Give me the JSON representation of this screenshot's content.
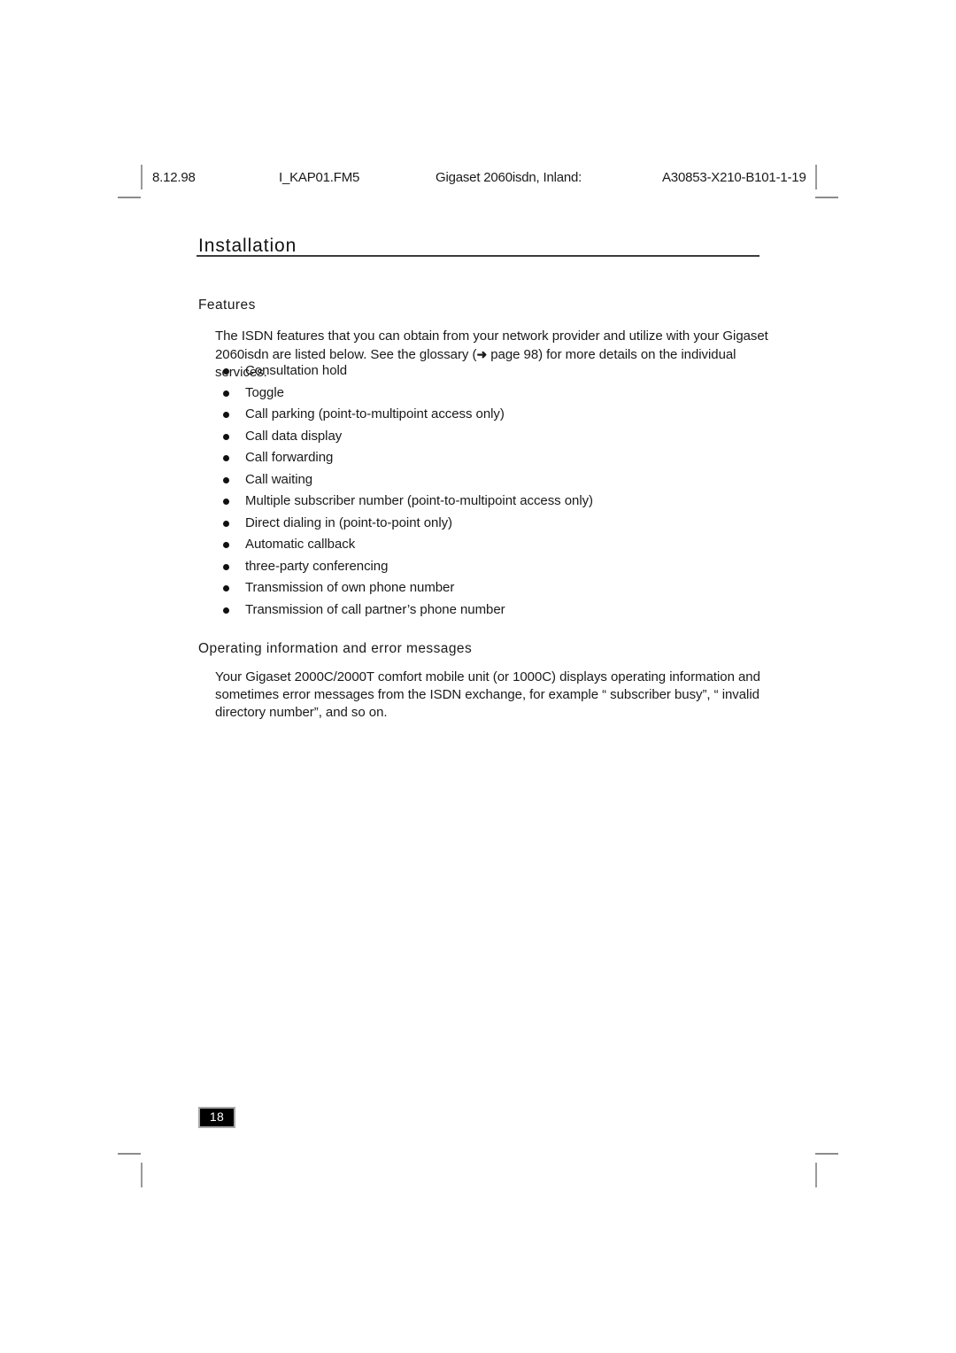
{
  "header": {
    "date": "8.12.98",
    "file": "I_KAP01.FM5",
    "document": "Gigaset 2060isdn, Inland:",
    "code": "A30853-X210-B101-1-19"
  },
  "chapter": {
    "title": "Installation"
  },
  "sections": [
    {
      "heading": "Features",
      "paragraph": "The ISDN features that you can obtain from your network provider and utilize with your Gigaset 2060isdn are listed below. See the glossary (",
      "paragraph_arrow": "➜",
      "paragraph_after_arrow": " page 98) for more details on the individual services."
    },
    {
      "heading": "Operating information and error messages",
      "paragraph": "Your Gigaset 2000C/2000T comfort mobile unit (or 1000C) displays operating information and sometimes error messages from the ISDN exchange, for example “ subscriber busy”, “ invalid directory number”, and so on."
    }
  ],
  "features": [
    "Consultation hold",
    "Toggle",
    "Call parking (point-to-multipoint access only)",
    "Call data display",
    "Call forwarding",
    "Call waiting",
    "Multiple subscriber number (point-to-multipoint access only)",
    "Direct dialing in (point-to-point only)",
    "Automatic callback",
    "three-party conferencing",
    "Transmission of own phone number",
    "Transmission of call partner’s phone number"
  ],
  "footer": {
    "page_number": "18"
  },
  "colors": {
    "text": "#1a1a1a",
    "rule": "#3b3b3b",
    "crop_mark": "#8c8c8c",
    "page_badge_bg": "#000000",
    "page_badge_border": "#a8a8a8",
    "page_badge_text": "#ffffff"
  }
}
